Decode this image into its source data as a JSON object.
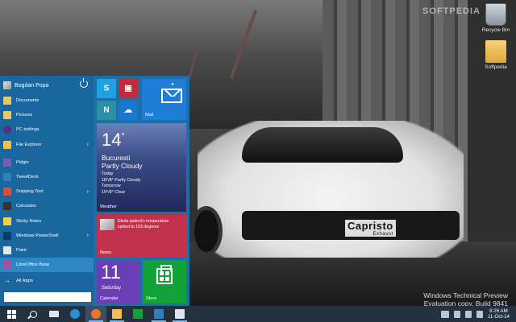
{
  "desktop": {
    "watermark": "SOFTPEDIA",
    "icons": [
      {
        "label": "Recycle Bin",
        "icon": "recycle-bin-icon"
      },
      {
        "label": "Softpedia",
        "icon": "folder-icon"
      }
    ],
    "car_brand": "Capristo",
    "car_sub": "Exhaust",
    "evaluation": {
      "line1": "Windows Technical Preview",
      "line2": "Evaluation copy. Build 9841"
    }
  },
  "start_menu": {
    "user_name": "Bogdan Popa",
    "items": [
      {
        "label": "Documents",
        "icon": "documents-icon",
        "color": "#e8c96a"
      },
      {
        "label": "Pictures",
        "icon": "pictures-icon",
        "color": "#e8c96a"
      },
      {
        "label": "PC settings",
        "icon": "gear-icon",
        "color": "#5a2d8c"
      },
      {
        "label": "File Explorer",
        "icon": "file-explorer-icon",
        "color": "#f0c050",
        "arrow": "›"
      },
      {
        "label": "Pidgin",
        "icon": "pidgin-icon",
        "color": "#7a5bbd"
      },
      {
        "label": "TweetDeck",
        "icon": "tweetdeck-icon",
        "color": "#2f7fc1"
      },
      {
        "label": "Snipping Tool",
        "icon": "scissors-icon",
        "color": "#d94d3a",
        "arrow": "›"
      },
      {
        "label": "Calculator",
        "icon": "calculator-icon",
        "color": "#333333"
      },
      {
        "label": "Sticky Notes",
        "icon": "sticky-notes-icon",
        "color": "#f2d24b"
      },
      {
        "label": "Windows PowerShell",
        "icon": "powershell-icon",
        "color": "#0c3a6b",
        "arrow": "›"
      },
      {
        "label": "Paint",
        "icon": "paint-icon",
        "color": "#e5e5e5"
      },
      {
        "label": "LibreOffice Base",
        "icon": "libreoffice-base-icon",
        "color": "#a74ea0"
      }
    ],
    "all_apps": "All Apps",
    "all_apps_arrow": "→"
  },
  "tiles": {
    "skype": {
      "icon": "skype-icon",
      "color": "#1fa0e0",
      "glyph": "S"
    },
    "video": {
      "icon": "video-icon",
      "color": "#c42b3a",
      "glyph": "▣"
    },
    "onenote": {
      "icon": "onenote-icon",
      "color": "#2a8fa7",
      "glyph": "N"
    },
    "onedrive": {
      "icon": "onedrive-icon",
      "color": "#1a78c8",
      "glyph": "☁"
    },
    "mail": {
      "name": "Mail",
      "color": "#1e7ed6"
    },
    "weather": {
      "name": "Weather",
      "temp": "14",
      "deg": "°",
      "city": "Bucuresti",
      "condition": "Partly Cloudy",
      "today_label": "Today",
      "today": "18°/8° Partly Cloudy",
      "tomorrow_label": "Tomorrow",
      "tomorrow": "19°/8° Clear"
    },
    "news": {
      "name": "News",
      "headline": "Ebola patient's temperature spiked to 103 degrees"
    },
    "calendar": {
      "name": "Calendar",
      "day_num": "11",
      "day_name": "Saturday"
    },
    "store": {
      "name": "Store"
    }
  },
  "taskbar": {
    "buttons": [
      {
        "name": "start-button",
        "icon": "windows-logo-icon"
      },
      {
        "name": "search-button",
        "icon": "search-icon"
      },
      {
        "name": "task-view-button",
        "icon": "task-view-icon",
        "color": "#e6e6e6"
      },
      {
        "name": "internet-explorer-button",
        "icon": "internet-explorer-icon",
        "color": "#2b8fd6"
      },
      {
        "name": "firefox-button",
        "icon": "firefox-icon",
        "color": "#e8772e"
      },
      {
        "name": "file-explorer-button",
        "icon": "folder-icon",
        "color": "#f0c050"
      },
      {
        "name": "store-button",
        "icon": "store-icon",
        "color": "#13a139"
      },
      {
        "name": "tweetdeck-button",
        "icon": "tweetdeck-icon",
        "color": "#2f7fc1"
      },
      {
        "name": "document-button",
        "icon": "document-icon",
        "color": "#d9e6f2"
      }
    ],
    "time": "8:26 AM",
    "date": "11-Oct-14"
  }
}
